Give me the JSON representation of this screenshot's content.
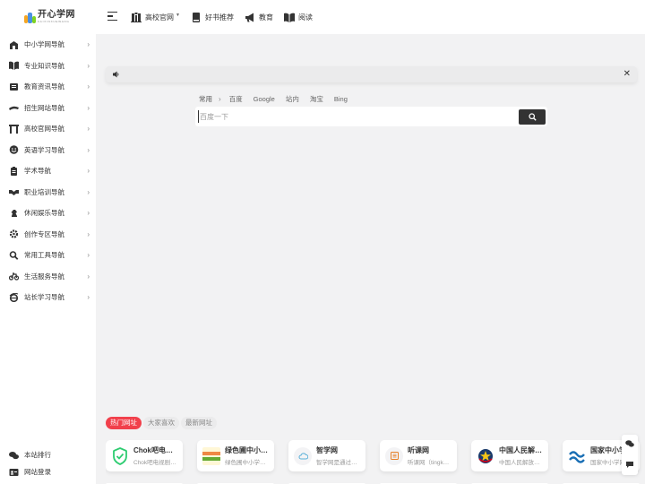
{
  "header": {
    "logo_title": "开心学网",
    "logo_subtitle": "KAIXINXUEWANG",
    "nav": [
      {
        "label": "高校官网",
        "icon": "university-icon",
        "has_dropdown": true
      },
      {
        "label": "好书推荐",
        "icon": "book-icon",
        "has_dropdown": false
      },
      {
        "label": "教育",
        "icon": "megaphone-icon",
        "has_dropdown": false
      },
      {
        "label": "阅读",
        "icon": "open-book-icon",
        "has_dropdown": false
      }
    ]
  },
  "sidebar": {
    "items": [
      {
        "label": "中小学网导航",
        "icon": "school-icon"
      },
      {
        "label": "专业知识导航",
        "icon": "book-open-icon"
      },
      {
        "label": "教育资讯导航",
        "icon": "newspaper-icon"
      },
      {
        "label": "招生网站导航",
        "icon": "graduation-cap-icon"
      },
      {
        "label": "高校官网导航",
        "icon": "gate-icon"
      },
      {
        "label": "英语学习导航",
        "icon": "smile-icon"
      },
      {
        "label": "学术导航",
        "icon": "clipboard-icon"
      },
      {
        "label": "职业培训导航",
        "icon": "handshake-icon"
      },
      {
        "label": "休闲娱乐导航",
        "icon": "chess-knight-icon"
      },
      {
        "label": "创作专区导航",
        "icon": "gear-icon"
      },
      {
        "label": "常用工具导航",
        "icon": "search-icon"
      },
      {
        "label": "生活服务导航",
        "icon": "bicycle-icon"
      },
      {
        "label": "站长学习导航",
        "icon": "ie-icon"
      }
    ],
    "bottom": [
      {
        "label": "本站排行",
        "icon": "chat-icon"
      },
      {
        "label": "网站登录",
        "icon": "id-card-icon"
      }
    ]
  },
  "notice": {
    "text": ""
  },
  "search": {
    "group_label": "常用",
    "engines": [
      "百度",
      "Google",
      "站内",
      "淘宝",
      "Bing"
    ],
    "placeholder": "百度一下"
  },
  "site_tabs": [
    "热门网址",
    "大家喜欢",
    "最新网址"
  ],
  "cards": [
    {
      "title": "Chok吧电…",
      "desc": "Chok吧电视剧…",
      "icon": "shield-check-icon"
    },
    {
      "title": "绿色圃中小…",
      "desc": "绿色圃中小学…",
      "icon": "lvsepu-logo-icon"
    },
    {
      "title": "智学网",
      "desc": "智学网是通过…",
      "icon": "cloud-icon"
    },
    {
      "title": "听课网",
      "desc": "听课网（tingk…",
      "icon": "tingke-logo-icon"
    },
    {
      "title": "中国人民解…",
      "desc": "中国人民解放…",
      "icon": "emblem-icon"
    },
    {
      "title": "国家中小学…",
      "desc": "国家中小学网…",
      "icon": "wave-logo-icon"
    }
  ],
  "colors": {
    "accent": "#f1404b",
    "dark": "#333333",
    "bg": "#f2f2f3"
  }
}
